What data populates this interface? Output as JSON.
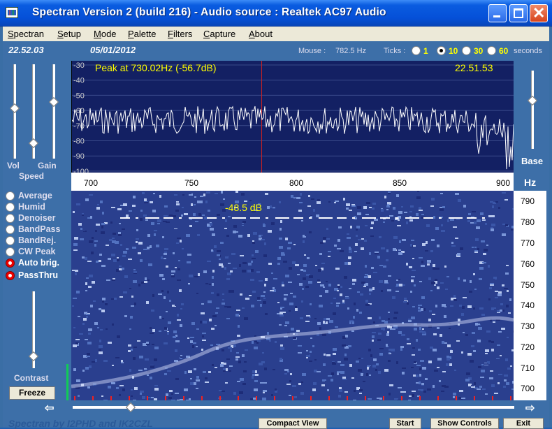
{
  "window": {
    "title": "Spectran Version 2 (build 216) - Audio source  :  Realtek AC97 Audio"
  },
  "menu": [
    "Spectran",
    "Setup",
    "Mode",
    "Palette",
    "Filters",
    "Capture",
    "About"
  ],
  "info": {
    "time": "22.52.03",
    "date": "05/01/2012",
    "mouse_label": "Mouse :",
    "mouse_value": "782.5 Hz",
    "ticks_label": "Ticks :",
    "tick_options": [
      "1",
      "10",
      "30",
      "60"
    ],
    "tick_selected": "10",
    "seconds_label": "seconds"
  },
  "left_controls": {
    "vol_label": "Vol",
    "gain_label": "Gain",
    "speed_label": "Speed",
    "options": [
      {
        "label": "Average",
        "active": false
      },
      {
        "label": "Humid",
        "active": false
      },
      {
        "label": "Denoiser",
        "active": false
      },
      {
        "label": "BandPass",
        "active": false
      },
      {
        "label": "BandRej.",
        "active": false
      },
      {
        "label": "CW Peak",
        "active": false
      },
      {
        "label": "Auto brig.",
        "active": true
      },
      {
        "label": "PassThru",
        "active": true
      }
    ],
    "contrast_label": "Contrast",
    "freeze_label": "Freeze"
  },
  "spectrum": {
    "peak_text": "Peak at  730.02Hz (-56.7dB)",
    "time_text": "22.51.53",
    "y_ticks": [
      "-30",
      "-40",
      "-50",
      "-60",
      "-70",
      "-80",
      "-90",
      "-100"
    ],
    "x_ticks": [
      "700",
      "750",
      "800",
      "850",
      "900"
    ],
    "cursor_hz": 782.5
  },
  "right_controls": {
    "base_label": "Base",
    "hz_label": "Hz"
  },
  "waterfall": {
    "db_label": "-48.5 dB",
    "y_ticks": [
      "790",
      "780",
      "770",
      "760",
      "750",
      "740",
      "730",
      "720",
      "710",
      "700"
    ]
  },
  "bottom": {
    "left_arrow": "⇦",
    "right_arrow": "⇨",
    "status": "Spectran  by I2PHD and IK2CZL",
    "buttons": [
      "Compact View",
      "Start",
      "Show Controls",
      "Exit"
    ]
  }
}
